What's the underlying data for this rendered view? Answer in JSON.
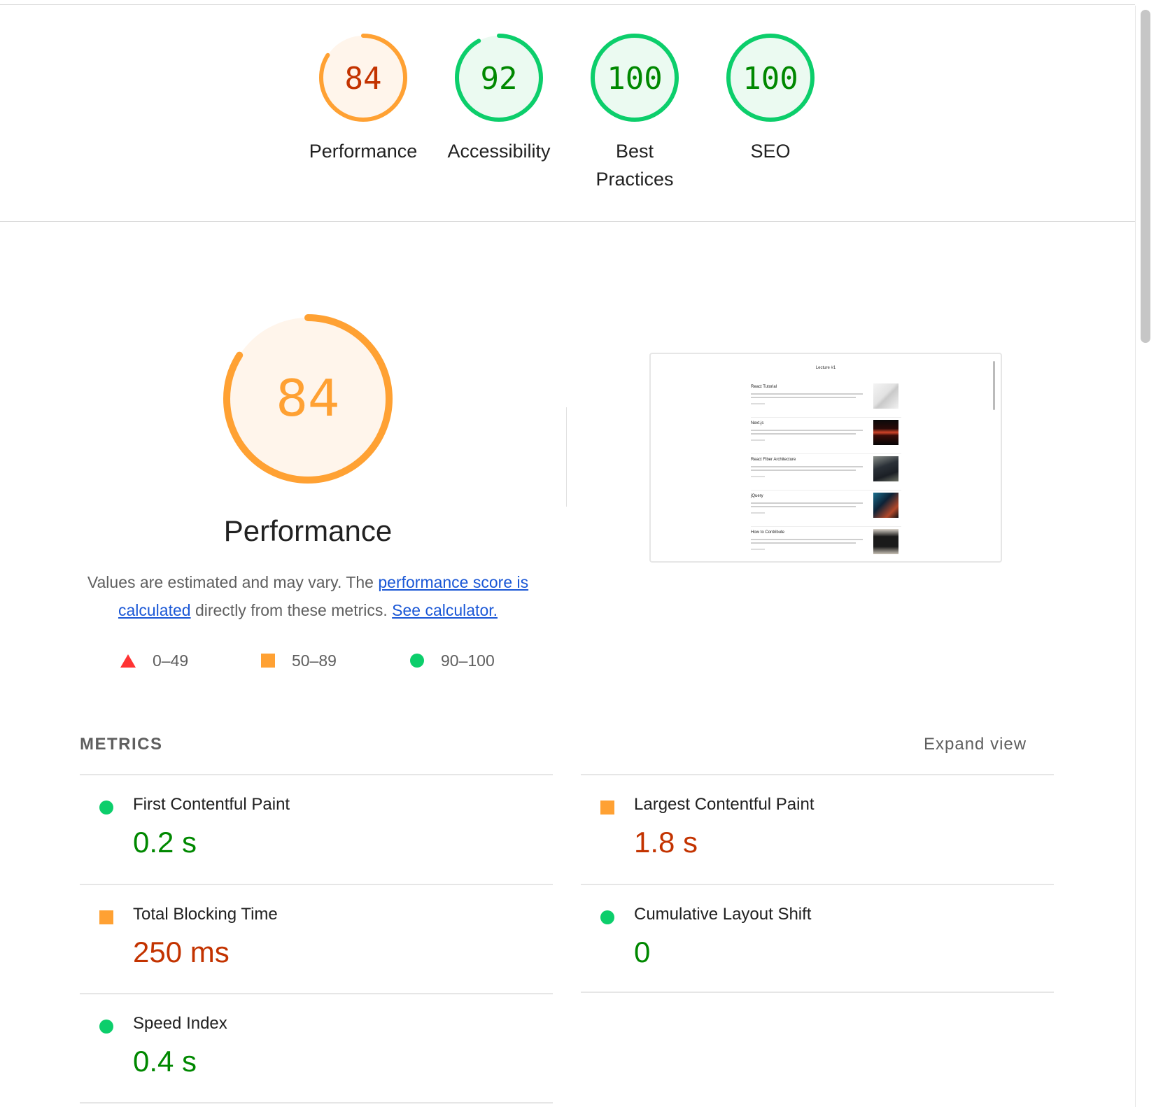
{
  "colors": {
    "pass": "#0cce6b",
    "average": "#ffa133",
    "fail": "#ff3333",
    "pass_text": "#008800",
    "average_text": "#c33300",
    "link": "#1a57d6"
  },
  "header": {
    "categories": [
      {
        "label": "Performance",
        "score": "84",
        "fraction": 0.84,
        "status": "average"
      },
      {
        "label": "Accessibility",
        "score": "92",
        "fraction": 0.92,
        "status": "pass"
      },
      {
        "label": "Best Practices",
        "score": "100",
        "fraction": 1.0,
        "status": "pass"
      },
      {
        "label": "SEO",
        "score": "100",
        "fraction": 1.0,
        "status": "pass"
      }
    ]
  },
  "performance": {
    "score": "84",
    "fraction": 0.84,
    "title": "Performance",
    "desc_text_1": "Values are estimated and may vary. The ",
    "desc_link_1": "performance score is calculated",
    "desc_text_2": " directly from these metrics. ",
    "desc_link_2": "See calculator.",
    "legend": [
      {
        "shape": "triangle",
        "range": "0–49"
      },
      {
        "shape": "square",
        "range": "50–89"
      },
      {
        "shape": "circle",
        "range": "90–100"
      }
    ]
  },
  "screenshot": {
    "title": "Lecture #1",
    "items": [
      {
        "title": "React Tutorial",
        "image": "paper-image"
      },
      {
        "title": "Next.js",
        "image": "dark-red-image"
      },
      {
        "title": "React Fiber Architecture",
        "image": "laptop-image"
      },
      {
        "title": "jQuery",
        "image": "keyboard-image"
      },
      {
        "title": "How to Contribute",
        "image": "monitor-image"
      }
    ]
  },
  "metrics": {
    "heading": "METRICS",
    "expand_label": "Expand view",
    "items": [
      {
        "name": "First Contentful Paint",
        "value": "0.2 s",
        "status": "pass"
      },
      {
        "name": "Largest Contentful Paint",
        "value": "1.8 s",
        "status": "average"
      },
      {
        "name": "Total Blocking Time",
        "value": "250 ms",
        "status": "average"
      },
      {
        "name": "Cumulative Layout Shift",
        "value": "0",
        "status": "pass"
      },
      {
        "name": "Speed Index",
        "value": "0.4 s",
        "status": "pass"
      }
    ]
  }
}
